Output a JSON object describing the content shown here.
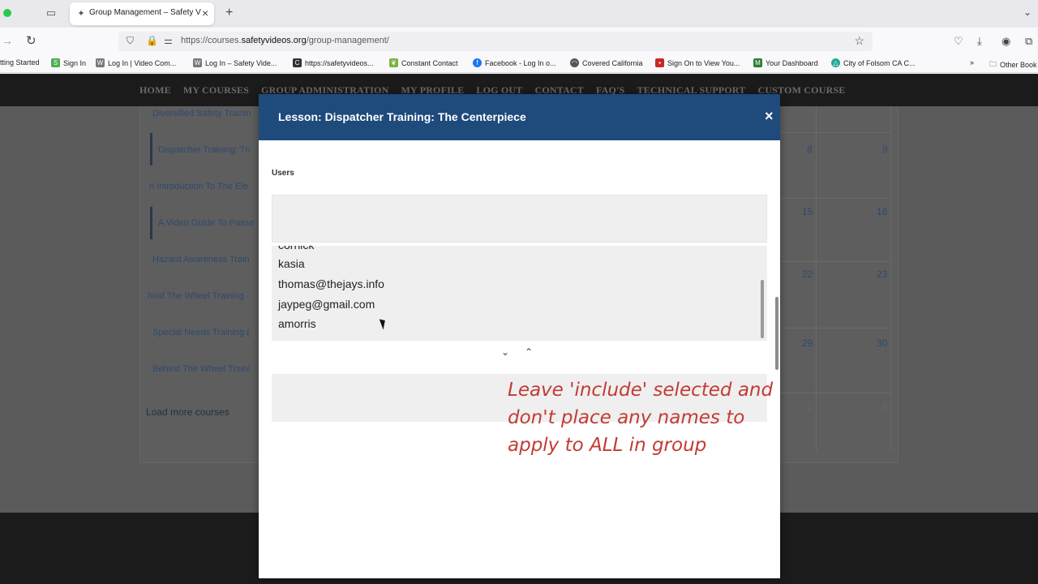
{
  "browser": {
    "tab_title": "Group Management – Safety Vi",
    "url_prefix": "https://courses.",
    "url_domain": "safetyvideos.org",
    "url_path": "/group-management/",
    "bookmarks": [
      "tting Started",
      "Sign In",
      "Log In | Video Com...",
      "Log In – Safety Vide...",
      "https://safetyvideos...",
      "Constant Contact",
      "Facebook - Log In o...",
      "Covered California",
      "Sign On to View You...",
      "Your Dashboard",
      "City of Folsom CA C...",
      "Other Book"
    ]
  },
  "site": {
    "nav": [
      "HOME",
      "MY COURSES",
      "GROUP ADMINISTRATION",
      "MY PROFILE",
      "LOG OUT",
      "CONTACT",
      "FAQ'S",
      "TECHNICAL SUPPORT",
      "CUSTOM COURSE"
    ],
    "courses": [
      "Diversified Safety Trainin",
      "Dispatcher Training: Th",
      "n Introduction To The Ele",
      "A Video Guide To Passe",
      "Hazard Awareness Train",
      "hind The Wheel Training -",
      "Special Needs Training (",
      "Behind The Wheel Traini"
    ],
    "load_more": "Load more courses",
    "calendar_numbers": [
      "8",
      "9",
      "15",
      "16",
      "22",
      "23",
      "29",
      "30",
      "5",
      "6"
    ]
  },
  "modal": {
    "title": "Lesson: Dispatcher Training: The Centerpiece",
    "close": "×",
    "users_label": "Users",
    "users": [
      "cornick",
      "kasia",
      "thomas@thejays.info",
      "jaypeg@gmail.com",
      "amorris"
    ],
    "down_arrow": "⌄",
    "up_arrow": "⌃"
  },
  "annotation": "Leave 'include' selected and don't place any names to apply to ALL in group"
}
